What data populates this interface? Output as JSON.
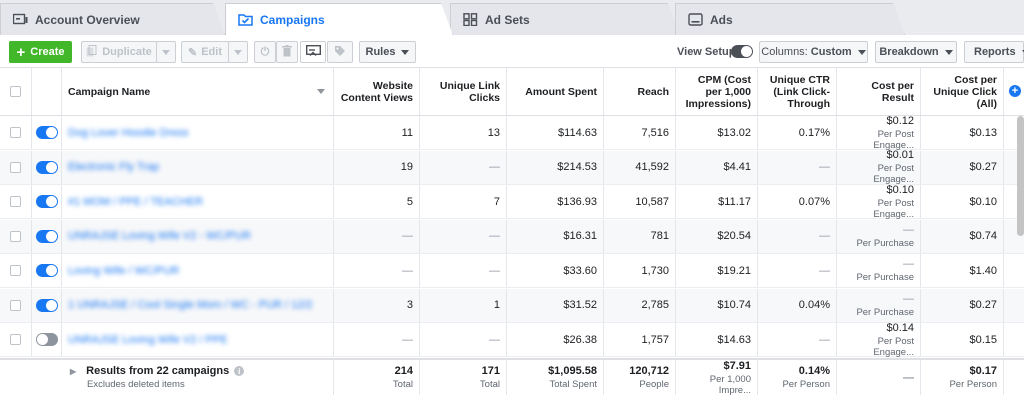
{
  "tabs": [
    {
      "label": "Account Overview",
      "icon": "account-overview-icon"
    },
    {
      "label": "Campaigns",
      "icon": "campaigns-folder-icon"
    },
    {
      "label": "Ad Sets",
      "icon": "ad-sets-grid-icon"
    },
    {
      "label": "Ads",
      "icon": "ads-icon"
    }
  ],
  "toolbar": {
    "create": "Create",
    "duplicate": "Duplicate",
    "edit": "Edit",
    "rules": "Rules",
    "view_setup": "View Setup",
    "columns_prefix": "Columns:",
    "columns_value": "Custom",
    "breakdown": "Breakdown",
    "reports": "Reports"
  },
  "columns": {
    "name": "Campaign Name",
    "views": "Website Content Views",
    "clicks": "Unique Link Clicks",
    "spent": "Amount Spent",
    "reach": "Reach",
    "cpm": "CPM (Cost per 1,000 Impressions)",
    "ctr": "Unique CTR (Link Click-Through",
    "cpr": "Cost per Result",
    "cpuc": "Cost per Unique Click (All)"
  },
  "rows": [
    {
      "on": true,
      "name": "Dog Lover Hoodie Dress",
      "views": "11",
      "clicks": "13",
      "spent": "$114.63",
      "reach": "7,516",
      "cpm": "$13.02",
      "ctr": "0.17%",
      "cpr": "$0.12",
      "cpr_sub": "Per Post Engage...",
      "cpuc": "$0.13"
    },
    {
      "on": true,
      "name": "Electronic Fly Trap",
      "views": "19",
      "clicks": "—",
      "spent": "$214.53",
      "reach": "41,592",
      "cpm": "$4.41",
      "ctr": "—",
      "cpr": "$0.01",
      "cpr_sub": "Per Post Engage...",
      "cpuc": "$0.27"
    },
    {
      "on": true,
      "name": "#1 MOM / PPE / TEACHER",
      "views": "5",
      "clicks": "7",
      "spent": "$136.93",
      "reach": "10,587",
      "cpm": "$11.17",
      "ctr": "0.07%",
      "cpr": "$0.10",
      "cpr_sub": "Per Post Engage...",
      "cpuc": "$0.10"
    },
    {
      "on": true,
      "name": "UNRAJSE Loving Wife V2 - WC/PUR",
      "views": "—",
      "clicks": "—",
      "spent": "$16.31",
      "reach": "781",
      "cpm": "$20.54",
      "ctr": "—",
      "cpr": "—",
      "cpr_sub": "Per Purchase",
      "cpuc": "$0.74"
    },
    {
      "on": true,
      "name": "Loving Wife / WC/PUR",
      "views": "—",
      "clicks": "—",
      "spent": "$33.60",
      "reach": "1,730",
      "cpm": "$19.21",
      "ctr": "—",
      "cpr": "—",
      "cpr_sub": "Per Purchase",
      "cpuc": "$1.40"
    },
    {
      "on": true,
      "name": "1 UNRAJSE / Cool Single Mom / WC - PUR / 12/2",
      "views": "3",
      "clicks": "1",
      "spent": "$31.52",
      "reach": "2,785",
      "cpm": "$10.74",
      "ctr": "0.04%",
      "cpr": "—",
      "cpr_sub": "Per Purchase",
      "cpuc": "$0.27"
    },
    {
      "on": false,
      "name": "UNRAJSE Loving Wife V2 / PPE",
      "views": "—",
      "clicks": "—",
      "spent": "$26.38",
      "reach": "1,757",
      "cpm": "$14.63",
      "ctr": "—",
      "cpr": "$0.14",
      "cpr_sub": "Per Post Engage...",
      "cpuc": "$0.15"
    }
  ],
  "totals": {
    "label": "Results from 22 campaigns",
    "sub": "Excludes deleted items",
    "views": "214",
    "views_sub": "Total",
    "clicks": "171",
    "clicks_sub": "Total",
    "spent": "$1,095.58",
    "spent_sub": "Total Spent",
    "reach": "120,712",
    "reach_sub": "People",
    "cpm": "$7.91",
    "cpm_sub": "Per 1,000 Impre...",
    "ctr": "0.14%",
    "ctr_sub": "Per Person",
    "cpr": "—",
    "cpuc": "$0.17",
    "cpuc_sub": "Per Person"
  },
  "colors": {
    "accent": "#1877f2",
    "create": "#42b72a"
  }
}
